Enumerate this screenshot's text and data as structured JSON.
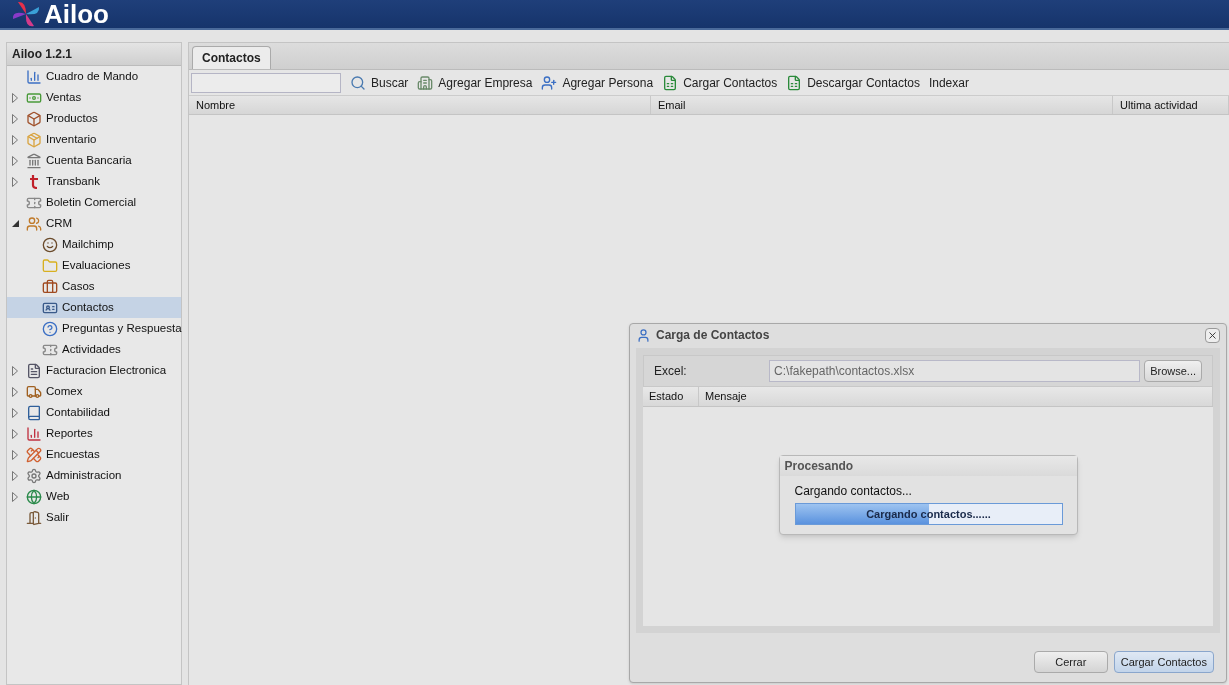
{
  "header": {
    "logo_text": "Ailoo"
  },
  "sidebar": {
    "title": "Ailoo 1.2.1",
    "items": [
      {
        "label": "Cuadro de Mando",
        "selected": false
      },
      {
        "label": "Ventas",
        "expanded": false,
        "selected": false
      },
      {
        "label": "Productos",
        "expanded": false,
        "selected": false
      },
      {
        "label": "Inventario",
        "expanded": false,
        "selected": false
      },
      {
        "label": "Cuenta Bancaria",
        "expanded": false,
        "selected": false
      },
      {
        "label": "Transbank",
        "expanded": false,
        "selected": false
      },
      {
        "label": "Boletin Comercial",
        "selected": false
      },
      {
        "label": "CRM",
        "expanded": true,
        "selected": false,
        "children": [
          {
            "label": "Mailchimp",
            "selected": false
          },
          {
            "label": "Evaluaciones",
            "selected": false
          },
          {
            "label": "Casos",
            "selected": false
          },
          {
            "label": "Contactos",
            "selected": true
          },
          {
            "label": "Preguntas y Respuesta",
            "selected": false
          },
          {
            "label": "Actividades",
            "selected": false
          }
        ]
      },
      {
        "label": "Facturacion Electronica",
        "expanded": false,
        "selected": false
      },
      {
        "label": "Comex",
        "expanded": false,
        "selected": false
      },
      {
        "label": "Contabilidad",
        "expanded": false,
        "selected": false
      },
      {
        "label": "Reportes",
        "expanded": false,
        "selected": false
      },
      {
        "label": "Encuestas",
        "expanded": false,
        "selected": false
      },
      {
        "label": "Administracion",
        "expanded": false,
        "selected": false
      },
      {
        "label": "Web",
        "expanded": false,
        "selected": false
      },
      {
        "label": "Salir",
        "selected": false
      }
    ]
  },
  "tabs": [
    {
      "label": "Contactos",
      "selected": true
    }
  ],
  "toolbar": {
    "buttons": [
      {
        "label": "Buscar",
        "kind": "search"
      },
      {
        "label": "Agregar Empresa",
        "kind": "building"
      },
      {
        "label": "Agregar Persona",
        "kind": "person"
      },
      {
        "label": "Cargar Contactos",
        "kind": "excel"
      },
      {
        "label": "Descargar Contactos",
        "kind": "excel"
      },
      {
        "label": "Indexar",
        "kind": "text"
      }
    ]
  },
  "table": {
    "columns": [
      "Nombre",
      "Email",
      "Ultima actividad"
    ]
  },
  "dialog": {
    "title": "Carga de Contactos",
    "file_label": "Excel:",
    "file_value": "C:\\fakepath\\contactos.xlsx",
    "browse": "Browse...",
    "columns": [
      "Estado",
      "Mensaje"
    ],
    "progress": {
      "title": "Procesando",
      "message": "Cargando contactos...",
      "bar_text": "Cargando contactos......",
      "level": 0.5
    },
    "buttons": [
      {
        "label": "Cerrar",
        "primary": false
      },
      {
        "label": "Cargar Contactos",
        "primary": true
      }
    ]
  }
}
